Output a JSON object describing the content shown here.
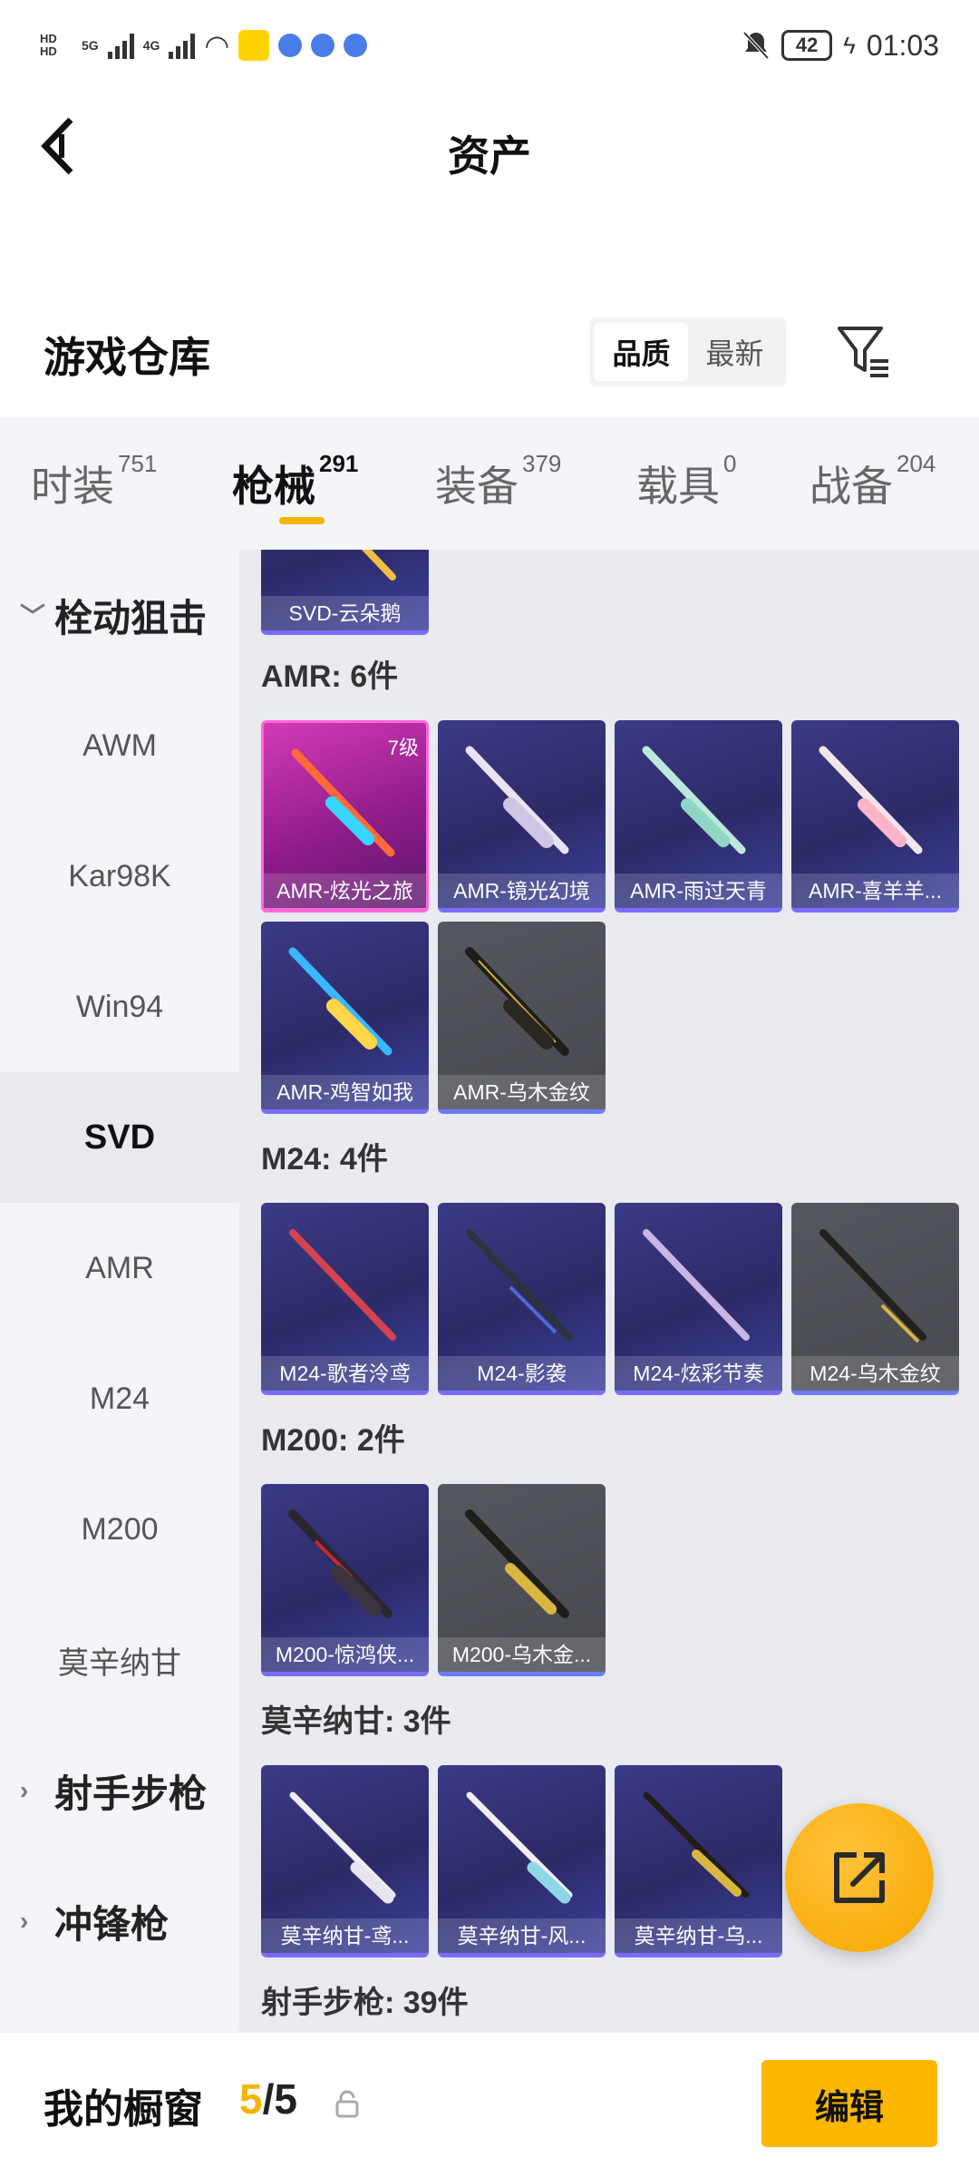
{
  "status_bar": {
    "network_label_1": "HD",
    "network_label_2": "HD",
    "signal_1": "5G",
    "signal_2": "4G",
    "battery": "42",
    "time": "01:03"
  },
  "header": {
    "title": "资产"
  },
  "warehouse": {
    "title": "游戏仓库",
    "sort_options": [
      "品质",
      "最新"
    ],
    "selected_sort": "品质"
  },
  "tabs": [
    {
      "label": "时装",
      "count": "751"
    },
    {
      "label": "枪械",
      "count": "291"
    },
    {
      "label": "装备",
      "count": "379"
    },
    {
      "label": "载具",
      "count": "0"
    },
    {
      "label": "战备",
      "count": "204"
    }
  ],
  "active_tab": "枪械",
  "sidebar": {
    "items": [
      {
        "label": "栓动狙击",
        "type": "group",
        "expanded": true
      },
      {
        "label": "AWM"
      },
      {
        "label": "Kar98K"
      },
      {
        "label": "Win94"
      },
      {
        "label": "SVD",
        "active": true
      },
      {
        "label": "AMR"
      },
      {
        "label": "M24"
      },
      {
        "label": "M200"
      },
      {
        "label": "莫辛纳甘"
      },
      {
        "label": "射手步枪",
        "type": "group",
        "expanded": false
      },
      {
        "label": "冲锋枪",
        "type": "group",
        "expanded": false
      }
    ]
  },
  "content": {
    "partial_card": {
      "name": "SVD-云朵鹅"
    },
    "sections": [
      {
        "label": "AMR: 6件",
        "items": [
          {
            "name": "AMR-炫光之旅",
            "level": "7级",
            "style": "pink"
          },
          {
            "name": "AMR-镜光幻境",
            "style": "purple"
          },
          {
            "name": "AMR-雨过天青",
            "style": "purple"
          },
          {
            "name": "AMR-喜羊羊...",
            "style": "purple"
          },
          {
            "name": "AMR-鸡智如我",
            "style": "purple"
          },
          {
            "name": "AMR-乌木金纹",
            "style": "gray"
          }
        ]
      },
      {
        "label": "M24: 4件",
        "items": [
          {
            "name": "M24-歌者泠鸢",
            "style": "purple"
          },
          {
            "name": "M24-影袭",
            "style": "purple"
          },
          {
            "name": "M24-炫彩节奏",
            "style": "purple"
          },
          {
            "name": "M24-乌木金纹",
            "style": "gray"
          }
        ]
      },
      {
        "label": "M200: 2件",
        "items": [
          {
            "name": "M200-惊鸿侠...",
            "style": "purple"
          },
          {
            "name": "M200-乌木金...",
            "style": "gray"
          }
        ]
      },
      {
        "label": "莫辛纳甘: 3件",
        "items": [
          {
            "name": "莫辛纳甘-鸢...",
            "style": "purple"
          },
          {
            "name": "莫辛纳甘-风...",
            "style": "purple"
          },
          {
            "name": "莫辛纳甘-乌...",
            "style": "purple"
          }
        ]
      },
      {
        "label": "射手步枪: 39件",
        "items": []
      }
    ]
  },
  "bottom_bar": {
    "title": "我的橱窗",
    "current": "5",
    "separator_total": "/5",
    "edit_label": "编辑"
  },
  "colors": {
    "accent": "#fdb700",
    "tab_underline": "#f5b400",
    "card_purple": "#35336f",
    "card_gray": "#4e5056",
    "card_pink": "#c23aa9"
  },
  "icons": {
    "back": "chevron-left-icon",
    "filter": "filter-icon",
    "share": "share-export-icon",
    "lock": "lock-icon"
  }
}
